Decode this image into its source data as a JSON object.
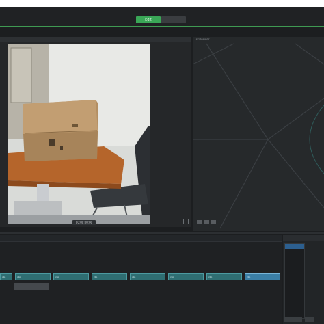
{
  "header": {
    "tabs": [
      {
        "label": "Edit",
        "active": true
      },
      {
        "label": "",
        "active": false
      }
    ]
  },
  "video": {
    "timecode": "00:00:00:00"
  },
  "viewer": {
    "title": "3D Viewer"
  },
  "timeline": {
    "clips": [
      {
        "label": "clip",
        "selected": false
      },
      {
        "label": "clip",
        "selected": false
      },
      {
        "label": "clip",
        "selected": false
      },
      {
        "label": "clip",
        "selected": false
      },
      {
        "label": "clip",
        "selected": false
      },
      {
        "label": "clip",
        "selected": false
      },
      {
        "label": "clip",
        "selected": false
      },
      {
        "label": "clip",
        "selected": true
      }
    ]
  },
  "properties": {
    "buttons": [
      "",
      ""
    ]
  },
  "colors": {
    "accent": "#3aa757",
    "clip": "#2f6e72",
    "clip_selected": "#3b7fa6"
  }
}
